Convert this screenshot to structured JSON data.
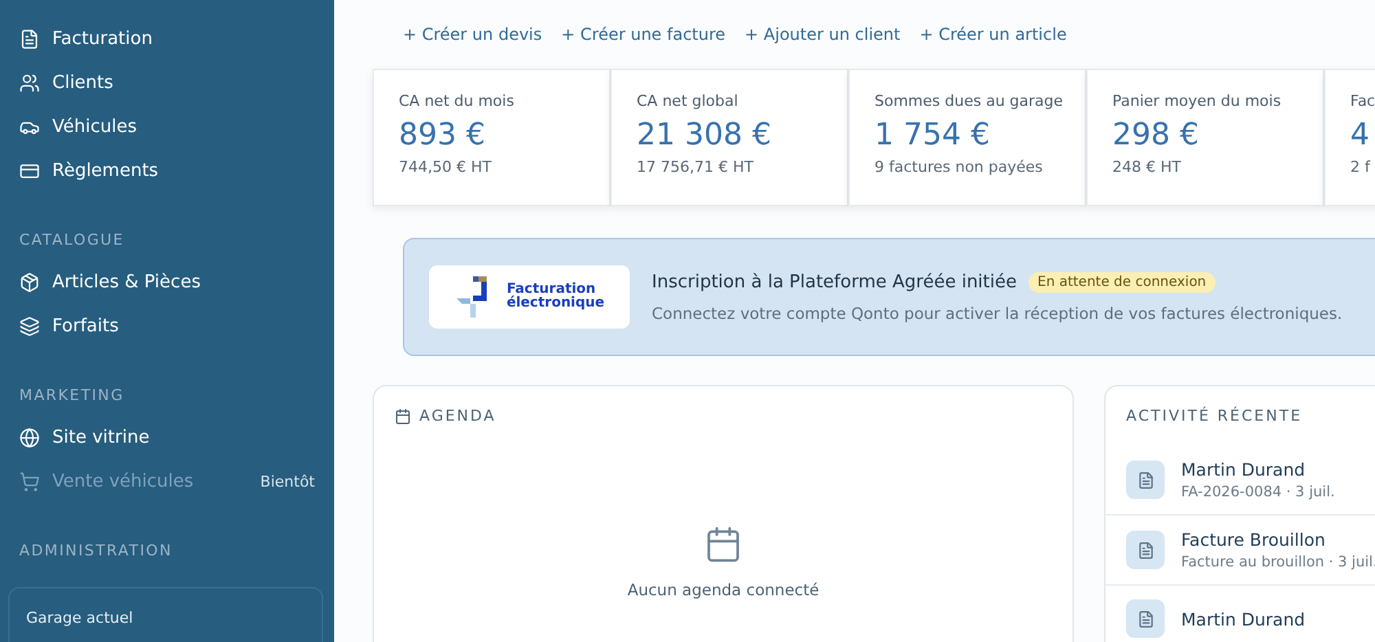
{
  "sidebar": {
    "sections": [
      {
        "items": [
          {
            "label": "Facturation",
            "disabled": false
          },
          {
            "label": "Clients",
            "disabled": false
          },
          {
            "label": "Véhicules",
            "disabled": false
          },
          {
            "label": "Règlements",
            "disabled": false
          }
        ]
      },
      {
        "title": "CATALOGUE",
        "items": [
          {
            "label": "Articles & Pièces",
            "disabled": false
          },
          {
            "label": "Forfaits",
            "disabled": false
          }
        ]
      },
      {
        "title": "MARKETING",
        "items": [
          {
            "label": "Site vitrine",
            "disabled": false
          },
          {
            "label": "Vente véhicules",
            "disabled": true,
            "badge": "Bientôt"
          }
        ]
      },
      {
        "title": "ADMINISTRATION"
      }
    ],
    "garage": {
      "label": "Garage actuel"
    }
  },
  "quick_actions": [
    "+ Créer un devis",
    "+ Créer une facture",
    "+ Ajouter un client",
    "+ Créer un article"
  ],
  "stats": [
    {
      "label": "CA net du mois",
      "value": "893 €",
      "sub": "744,50 € HT"
    },
    {
      "label": "CA net global",
      "value": "21 308 €",
      "sub": "17 756,71 € HT"
    },
    {
      "label": "Sommes dues au garage",
      "value": "1 754 €",
      "sub": "9 factures non payées"
    },
    {
      "label": "Panier moyen du mois",
      "value": "298 €",
      "sub": "248 € HT"
    },
    {
      "label": "Fac",
      "value": "4",
      "sub": "2 f"
    }
  ],
  "banner": {
    "logo_line1": "Facturation",
    "logo_line2": "électronique",
    "title": "Inscription à la Plateforme Agréée initiée",
    "badge": "En attente de connexion",
    "text": "Connectez votre compte Qonto pour activer la réception de vos factures électroniques."
  },
  "agenda": {
    "title": "AGENDA",
    "empty": "Aucun agenda connecté"
  },
  "activity": {
    "title": "ACTIVITÉ RÉCENTE",
    "items": [
      {
        "name": "Martin Durand",
        "detail": "FA-2026-0084 · 3 juil."
      },
      {
        "name": "Facture Brouillon",
        "detail": "Facture au brouillon · 3 juil."
      },
      {
        "name": "Martin Durand"
      }
    ]
  }
}
